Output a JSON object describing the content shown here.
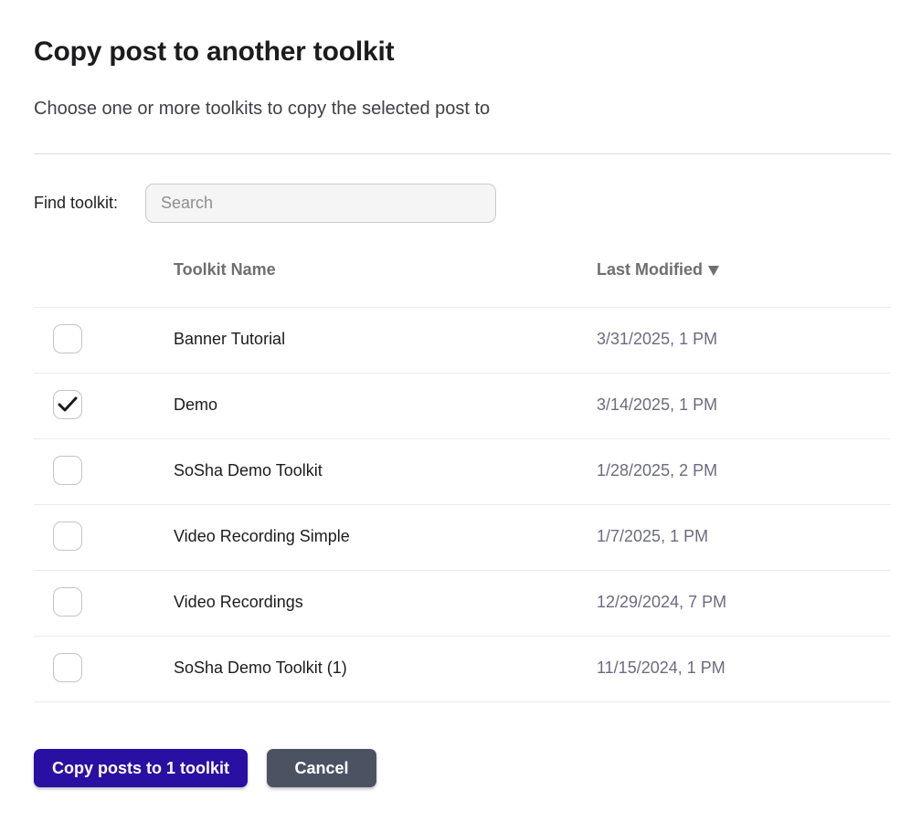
{
  "dialog": {
    "title": "Copy post to another toolkit",
    "subtitle": "Choose one or more toolkits to copy the selected post to"
  },
  "search": {
    "label": "Find toolkit:",
    "placeholder": "Search",
    "value": ""
  },
  "table": {
    "columns": {
      "name": "Toolkit Name",
      "modified": "Last Modified",
      "sort_icon": "triangle-down-icon"
    },
    "rows": [
      {
        "name": "Banner Tutorial",
        "modified": "3/31/2025, 1 PM",
        "checked": false
      },
      {
        "name": "Demo",
        "modified": "3/14/2025, 1 PM",
        "checked": true
      },
      {
        "name": "SoSha Demo Toolkit",
        "modified": "1/28/2025, 2 PM",
        "checked": false
      },
      {
        "name": "Video Recording Simple",
        "modified": "1/7/2025, 1 PM",
        "checked": false
      },
      {
        "name": "Video Recordings",
        "modified": "12/29/2024, 7 PM",
        "checked": false
      },
      {
        "name": "SoSha Demo Toolkit (1)",
        "modified": "11/15/2024, 1 PM",
        "checked": false
      }
    ]
  },
  "actions": {
    "copy_label": "Copy posts to 1 toolkit",
    "cancel_label": "Cancel"
  },
  "colors": {
    "primary": "#2a0fa3",
    "cancel": "#4b5363",
    "date_text": "#6b6b80",
    "header_text": "#6e6e73"
  }
}
